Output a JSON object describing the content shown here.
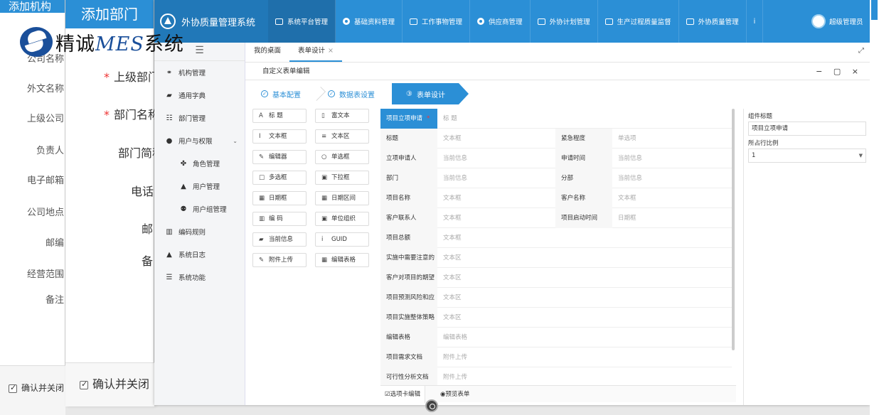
{
  "bg_window_1": {
    "title": "添加机构",
    "labels": [
      "公司名称",
      "外文名称",
      "上级公司",
      "负责人",
      "电子邮箱",
      "公司地点",
      "邮编",
      "经营范围",
      "备注"
    ],
    "confirm": "确认并关闭"
  },
  "bg_window_2": {
    "title": "添加部门",
    "labels": [
      "上级部门",
      "部门名称",
      "部门简称",
      "电话",
      "邮",
      "备"
    ],
    "confirm": "确认并关闭"
  },
  "logo": {
    "text_a": "精诚",
    "text_b": "MES",
    "text_c": "系统"
  },
  "app": {
    "title": "外协质量管理系统",
    "menu": [
      "系统平台管理",
      "基础资料管理",
      "工作事物管理",
      "供应商管理",
      "外协计划管理",
      "生产过程质量监督",
      "外协质量管理"
    ],
    "menu_more": "i",
    "user": "超级管理员"
  },
  "sidebar": {
    "toggle": "☰",
    "items": [
      {
        "label": "机构管理",
        "icon": "⚭"
      },
      {
        "label": "通用字典",
        "icon": "▰"
      },
      {
        "label": "部门管理",
        "icon": "☷"
      },
      {
        "label": "用户与权限",
        "icon": "●"
      },
      {
        "label": "角色管理",
        "icon": "✤"
      },
      {
        "label": "用户管理",
        "icon": "▲"
      },
      {
        "label": "用户组管理",
        "icon": "⚉"
      },
      {
        "label": "编码规则",
        "icon": "▥"
      },
      {
        "label": "系统日志",
        "icon": "▲"
      },
      {
        "label": "系统功能",
        "icon": "☰"
      }
    ]
  },
  "tabs": [
    {
      "label": "我的桌面"
    },
    {
      "label": "表单设计",
      "close": "×"
    }
  ],
  "panel": {
    "title": "自定义表单编辑",
    "win_controls": "− ▢ ×",
    "steps": [
      {
        "label": "基本配置",
        "mark": "✓"
      },
      {
        "label": "数据表设置",
        "mark": "✓"
      },
      {
        "label": "表单设计",
        "mark": "③"
      }
    ]
  },
  "toolbox": [
    {
      "label": "标 题",
      "icon": "A"
    },
    {
      "label": "富文本",
      "icon": "▯"
    },
    {
      "label": "文本框",
      "icon": "I"
    },
    {
      "label": "文本区",
      "icon": "≡"
    },
    {
      "label": "编辑器",
      "icon": "✎"
    },
    {
      "label": "单选框",
      "icon": "○"
    },
    {
      "label": "多选框",
      "icon": "□"
    },
    {
      "label": "下拉框",
      "icon": "▣"
    },
    {
      "label": "日期框",
      "icon": "▦"
    },
    {
      "label": "日期区间",
      "icon": "▦"
    },
    {
      "label": "编 码",
      "icon": "▥"
    },
    {
      "label": "单位组织",
      "icon": "▣"
    },
    {
      "label": "当前信息",
      "icon": "▰"
    },
    {
      "label": "GUID",
      "icon": "i"
    },
    {
      "label": "附件上传",
      "icon": "✎"
    },
    {
      "label": "编辑表格",
      "icon": "▦"
    }
  ],
  "form": {
    "rows": [
      {
        "l1": "项目立项申请",
        "v1": "标 题",
        "highlight": true,
        "star": "*"
      },
      {
        "l1": "标题",
        "v1": "文本框",
        "l2": "紧急程度",
        "v2": "单选项"
      },
      {
        "l1": "立项申请人",
        "v1": "当前信息",
        "l2": "申请时间",
        "v2": "当前信息"
      },
      {
        "l1": "部门",
        "v1": "当前信息",
        "l2": "分部",
        "v2": "当前信息"
      },
      {
        "l1": "项目名称",
        "v1": "文本框",
        "l2": "客户名称",
        "v2": "文本框"
      },
      {
        "l1": "客户联系人",
        "v1": "文本框",
        "l2": "项目启动时间",
        "v2": "日期框"
      },
      {
        "l1": "项目总额",
        "v1": "文本框"
      },
      {
        "l1": "实施中需要注意的",
        "v1": "文本区"
      },
      {
        "l1": "客户对项目的期望",
        "v1": "文本区"
      },
      {
        "l1": "项目预测风险和应",
        "v1": "文本区"
      },
      {
        "l1": "项目实施整体策略",
        "v1": "文本区"
      },
      {
        "l1": "编辑表格",
        "v1": "编辑表格"
      },
      {
        "l1": "项目需求文档",
        "v1": "附件上传"
      },
      {
        "l1": "可行性分析文档",
        "v1": "附件上传"
      }
    ],
    "footer": {
      "edit": "☑选项卡编辑",
      "preview": "◉预览表单"
    }
  },
  "props": {
    "title_label": "组件标题",
    "title_value": "项目立项申请",
    "ratio_label": "所占行比例",
    "ratio_value": "1"
  },
  "colors": {
    "accent": "#2b8fd6",
    "nav_dark": "#1f6fab"
  }
}
